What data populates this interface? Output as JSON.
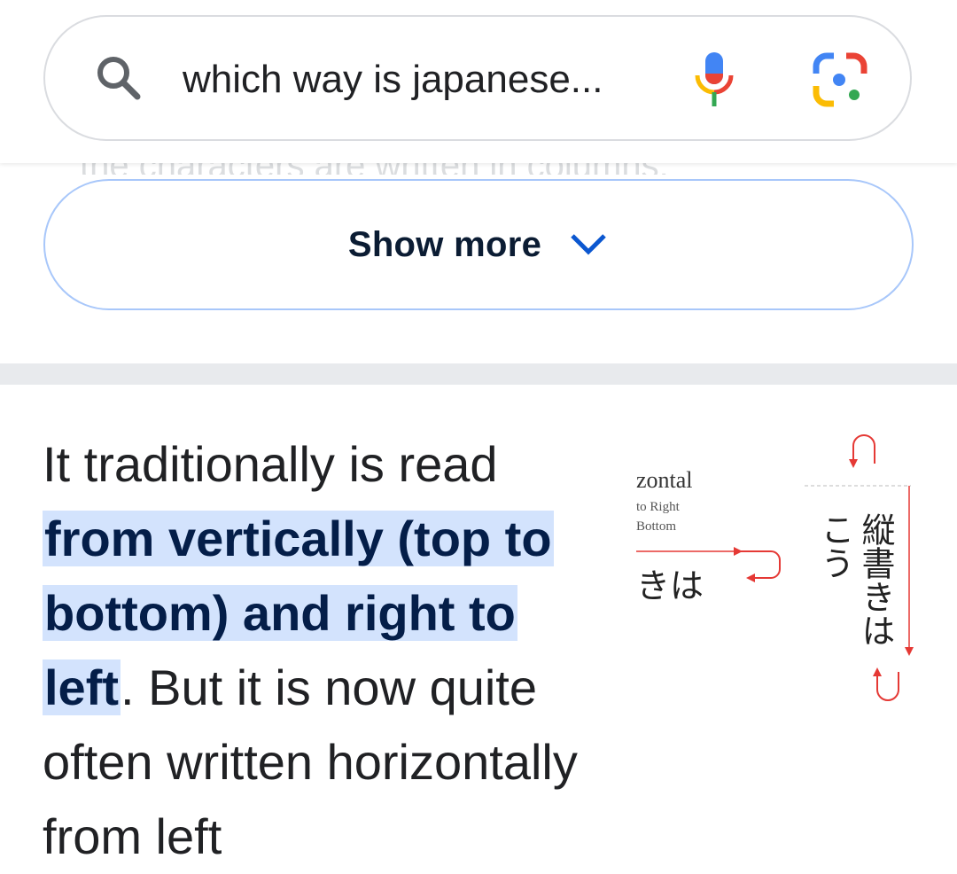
{
  "search": {
    "query": "which way is japanese..."
  },
  "peek_text": "the characters are written in columns.",
  "show_more": {
    "label": "Show more"
  },
  "snippet": {
    "lead": "It traditionally is read ",
    "highlight": "from vertically (top to bottom) and right to left",
    "rest": ". But it is now quite often written horizontally from left"
  },
  "image": {
    "horizontal_label": "zontal",
    "line1": "to Right",
    "line2": "Bottom",
    "horizontal_kana": "きは",
    "vertical_kana_1": "縦書きは",
    "vertical_kana_2": "こう"
  },
  "colors": {
    "accent_border": "#a8c7fa",
    "highlight_bg": "#d3e3fd",
    "google_blue": "#4285f4",
    "google_red": "#ea4335",
    "google_yellow": "#fbbc04",
    "google_green": "#34a853"
  }
}
